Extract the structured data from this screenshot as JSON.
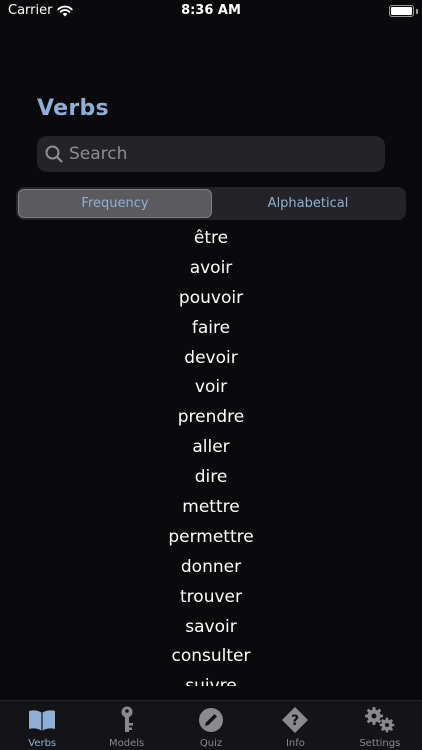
{
  "status_bar": {
    "carrier": "Carrier",
    "time": "8:36 AM"
  },
  "header": {
    "title": "Verbs"
  },
  "search": {
    "placeholder": "Search"
  },
  "sort": {
    "options": [
      "Frequency",
      "Alphabetical"
    ],
    "selected": "Frequency"
  },
  "verbs": [
    "être",
    "avoir",
    "pouvoir",
    "faire",
    "devoir",
    "voir",
    "prendre",
    "aller",
    "dire",
    "mettre",
    "permettre",
    "donner",
    "trouver",
    "savoir",
    "consulter",
    "suivre"
  ],
  "tabs": [
    {
      "label": "Verbs",
      "icon": "book-icon"
    },
    {
      "label": "Models",
      "icon": "key-icon"
    },
    {
      "label": "Quiz",
      "icon": "pencil-icon"
    },
    {
      "label": "Info",
      "icon": "question-icon"
    },
    {
      "label": "Settings",
      "icon": "gears-icon"
    }
  ],
  "colors": {
    "accent": "#8fb0d6",
    "background": "#0a090c",
    "inactive": "#8a898e"
  }
}
